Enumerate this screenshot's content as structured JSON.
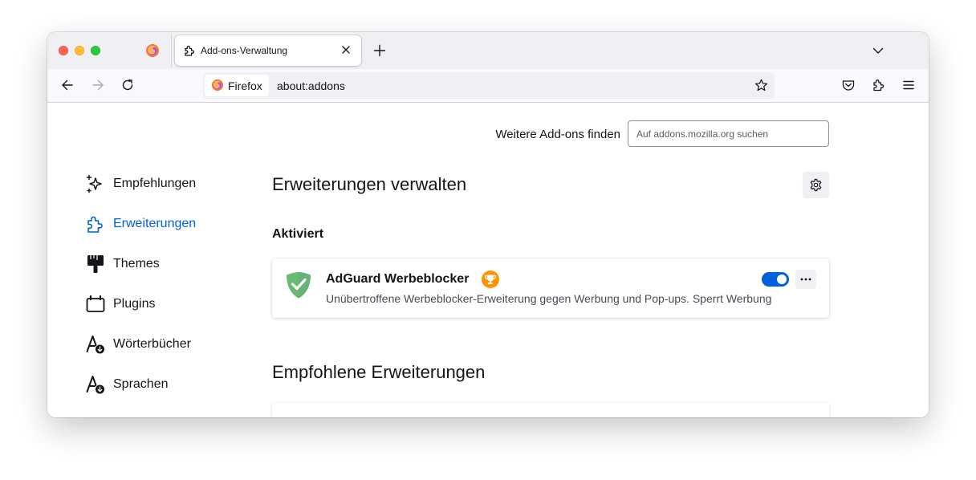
{
  "window": {
    "tab": {
      "title": "Add-ons-Verwaltung"
    }
  },
  "navbar": {
    "identity_label": "Firefox",
    "url": "about:addons"
  },
  "header": {
    "find_label": "Weitere Add-ons finden",
    "search_placeholder": "Auf addons.mozilla.org suchen"
  },
  "sidebar": {
    "items": [
      {
        "label": "Empfehlungen",
        "icon": "sparkles-icon"
      },
      {
        "label": "Erweiterungen",
        "icon": "puzzle-icon",
        "selected": true
      },
      {
        "label": "Themes",
        "icon": "paintbrush-icon"
      },
      {
        "label": "Plugins",
        "icon": "plugin-icon"
      },
      {
        "label": "Wörterbücher",
        "icon": "dictionary-icon"
      },
      {
        "label": "Sprachen",
        "icon": "language-icon"
      }
    ]
  },
  "main": {
    "heading": "Erweiterungen verwalten",
    "enabled_section": "Aktiviert",
    "addon": {
      "name": "AdGuard Werbeblocker",
      "description": "Unübertroffene Werbeblocker-Erweiterung gegen Werbung und Pop-ups. Sperrt Werbung",
      "enabled": true
    },
    "recommended_heading": "Empfohlene Erweiterungen"
  },
  "colors": {
    "accent": "#0061e0",
    "adguard_green": "#68bc71",
    "badge_orange": "#ff9400",
    "close_red": "#ff5f57",
    "minimize_yellow": "#febc2e",
    "zoom_green": "#28c840"
  }
}
